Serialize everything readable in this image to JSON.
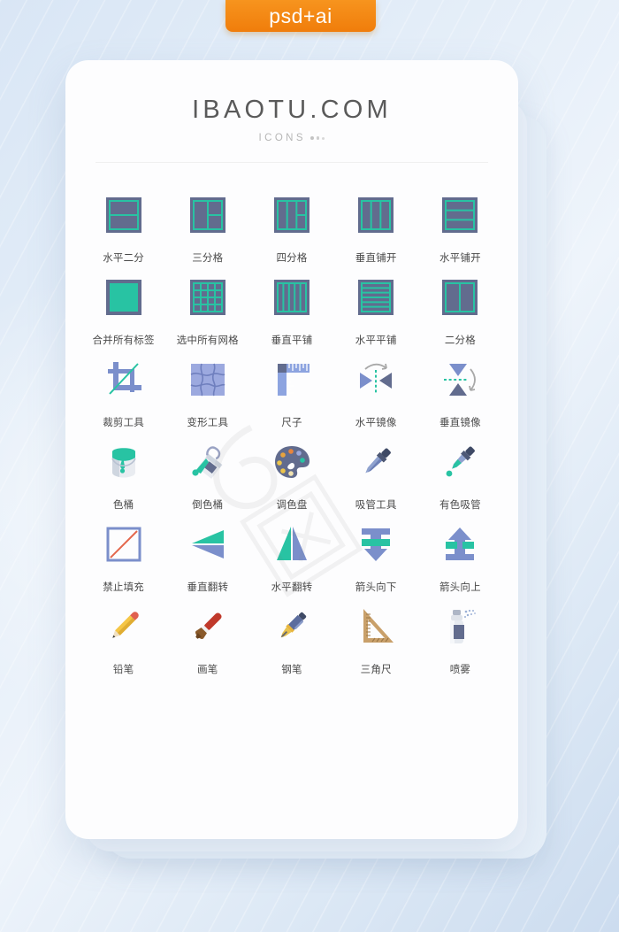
{
  "badge": {
    "label": "psd+ai",
    "color": "#f7941e"
  },
  "header": {
    "brand": "IBAOTU.COM",
    "subtitle": "ICONS"
  },
  "palette": {
    "slate": "#626C8E",
    "teal": "#28C3A3",
    "periwinkle": "#8A98D8",
    "steel_blue": "#7B8FCB",
    "label_text": "#4a4a4a",
    "panel_bg": "#fdfdfe",
    "page_bg": "#dce8f5"
  },
  "watermark": {
    "text": "6图网"
  },
  "icons": [
    {
      "id": "split-horizontal-2",
      "label": "水平二分",
      "icon": "grid-h2"
    },
    {
      "id": "grid-3",
      "label": "三分格",
      "icon": "grid-3"
    },
    {
      "id": "grid-4",
      "label": "四分格",
      "icon": "grid-4"
    },
    {
      "id": "tile-vertical-open",
      "label": "垂直铺开",
      "icon": "grid-v3"
    },
    {
      "id": "tile-horizontal-open",
      "label": "水平铺开",
      "icon": "grid-h3"
    },
    {
      "id": "merge-all-labels",
      "label": "合并所有标签",
      "icon": "solid-fill"
    },
    {
      "id": "select-all-cells",
      "label": "选中所有网格",
      "icon": "grid-4x4"
    },
    {
      "id": "tile-vertical",
      "label": "垂直平铺",
      "icon": "grid-v5"
    },
    {
      "id": "tile-horizontal",
      "label": "水平平铺",
      "icon": "grid-h6"
    },
    {
      "id": "grid-2",
      "label": "二分格",
      "icon": "grid-v2"
    },
    {
      "id": "crop-tool",
      "label": "裁剪工具",
      "icon": "crop"
    },
    {
      "id": "transform-tool",
      "label": "变形工具",
      "icon": "warp"
    },
    {
      "id": "ruler",
      "label": "尺子",
      "icon": "ruler"
    },
    {
      "id": "flip-mirror-h",
      "label": "水平镜像",
      "icon": "mirror-h"
    },
    {
      "id": "flip-mirror-v",
      "label": "垂直镜像",
      "icon": "mirror-v"
    },
    {
      "id": "paint-bucket",
      "label": "色桶",
      "icon": "bucket"
    },
    {
      "id": "pour-bucket",
      "label": "倒色桶",
      "icon": "bucket-pour"
    },
    {
      "id": "palette",
      "label": "调色盘",
      "icon": "palette"
    },
    {
      "id": "eyedropper",
      "label": "吸管工具",
      "icon": "dropper"
    },
    {
      "id": "eyedropper-color",
      "label": "有色吸管",
      "icon": "dropper-color"
    },
    {
      "id": "no-fill",
      "label": "禁止填充",
      "icon": "no-fill"
    },
    {
      "id": "flip-vertical",
      "label": "垂直翻转",
      "icon": "flip-v"
    },
    {
      "id": "flip-horizontal",
      "label": "水平翻转",
      "icon": "flip-h"
    },
    {
      "id": "arrow-down",
      "label": "箭头向下",
      "icon": "arrow-down"
    },
    {
      "id": "arrow-up",
      "label": "箭头向上",
      "icon": "arrow-up"
    },
    {
      "id": "pencil",
      "label": "铅笔",
      "icon": "pencil"
    },
    {
      "id": "paintbrush",
      "label": "画笔",
      "icon": "brush"
    },
    {
      "id": "fountain-pen",
      "label": "钢笔",
      "icon": "pen"
    },
    {
      "id": "set-square",
      "label": "三角尺",
      "icon": "triangle-ruler"
    },
    {
      "id": "spray",
      "label": "喷雾",
      "icon": "spray"
    }
  ]
}
